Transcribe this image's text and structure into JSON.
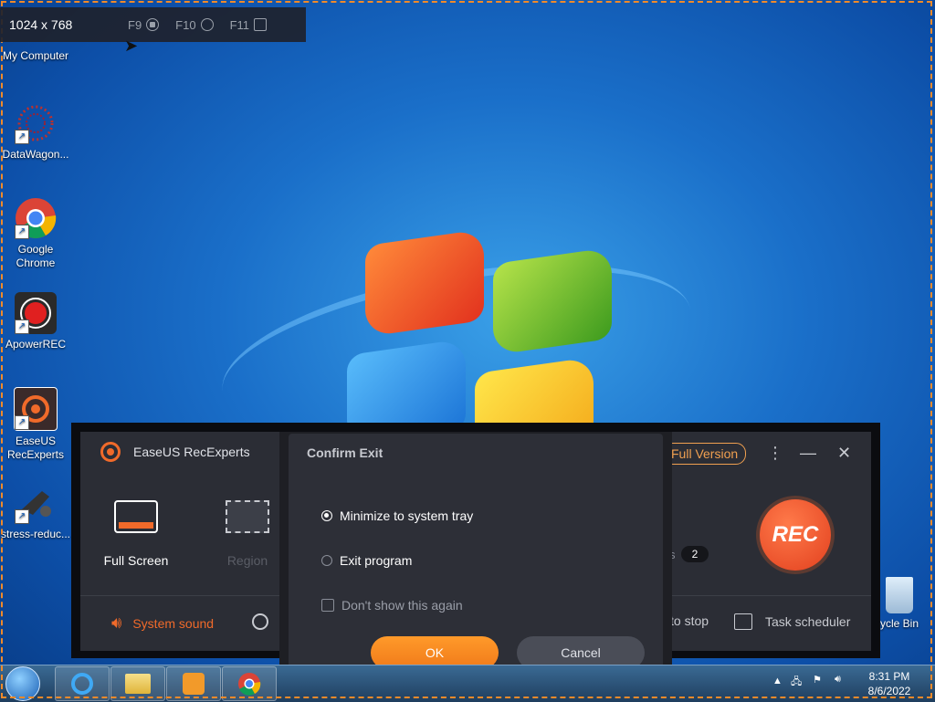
{
  "capture_bar": {
    "dimensions": "1024 x 768",
    "hotkeys": [
      {
        "key": "F9",
        "icon": "stop-record-icon"
      },
      {
        "key": "F10",
        "icon": "pause-icon"
      },
      {
        "key": "F11",
        "icon": "camera-icon"
      }
    ]
  },
  "desktop": {
    "icons": [
      {
        "label": "My Computer",
        "icon": "computer-icon"
      },
      {
        "label": "DataWagon...",
        "icon": "datawagon-icon"
      },
      {
        "label": "Google Chrome",
        "icon": "chrome-icon"
      },
      {
        "label": "ApowerREC",
        "icon": "apowerrec-icon"
      },
      {
        "label": "EaseUS RecExperts",
        "icon": "easeus-icon"
      },
      {
        "label": "stress-reduc...",
        "icon": "stress-icon"
      }
    ],
    "recycle_bin": "ycle Bin"
  },
  "recorder": {
    "app_title": "EaseUS RecExperts",
    "full_version": "Full Version",
    "modes": [
      {
        "label": "Full Screen",
        "icon": "full-screen-icon"
      },
      {
        "label": "Region",
        "icon": "region-icon"
      }
    ],
    "system_sound": "System sound",
    "auto_stop": "to stop",
    "task_scheduler": "Task scheduler",
    "rec_label": "REC",
    "badge_prefix": "s",
    "badge_count": "2"
  },
  "dialog": {
    "title": "Confirm Exit",
    "options": [
      {
        "label": "Minimize to system tray",
        "selected": true
      },
      {
        "label": "Exit program",
        "selected": false
      }
    ],
    "dont_show": "Don't show this again",
    "ok": "OK",
    "cancel": "Cancel"
  },
  "taskbar": {
    "time": "8:31 PM",
    "date": "8/6/2022",
    "pinned": [
      "internet-explorer-icon",
      "file-explorer-icon",
      "media-player-icon",
      "chrome-icon"
    ]
  },
  "colors": {
    "accent": "#f06a2a",
    "ok_button": "#ff8a22",
    "dialog_bg": "#2d2f37",
    "recorder_bg": "#2b2d35"
  }
}
